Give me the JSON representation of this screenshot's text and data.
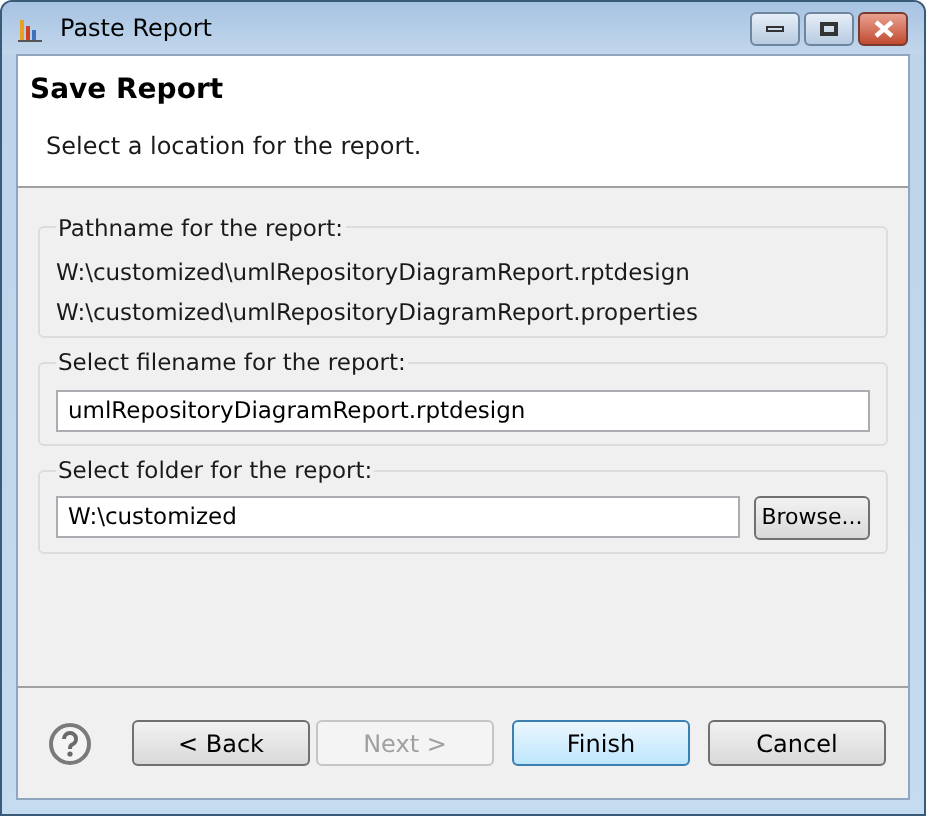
{
  "window": {
    "title": "Paste Report"
  },
  "header": {
    "title": "Save Report",
    "description": "Select a location for the report."
  },
  "pathname_group": {
    "label": "Pathname for the report:",
    "paths": [
      "W:\\customized\\umlRepositoryDiagramReport.rptdesign",
      "W:\\customized\\umlRepositoryDiagramReport.properties"
    ]
  },
  "filename_group": {
    "label": "Select filename for the report:",
    "value": "umlRepositoryDiagramReport.rptdesign"
  },
  "folder_group": {
    "label": "Select folder for the report:",
    "value": "W:\\customized",
    "button": "Browse..."
  },
  "buttons": [
    {
      "label": "< Back",
      "disabled": false,
      "default": false
    },
    {
      "label": "Next >",
      "disabled": true,
      "default": false
    },
    {
      "label": "Finish",
      "disabled": false,
      "default": true
    },
    {
      "label": "Cancel",
      "disabled": false,
      "default": false
    }
  ]
}
